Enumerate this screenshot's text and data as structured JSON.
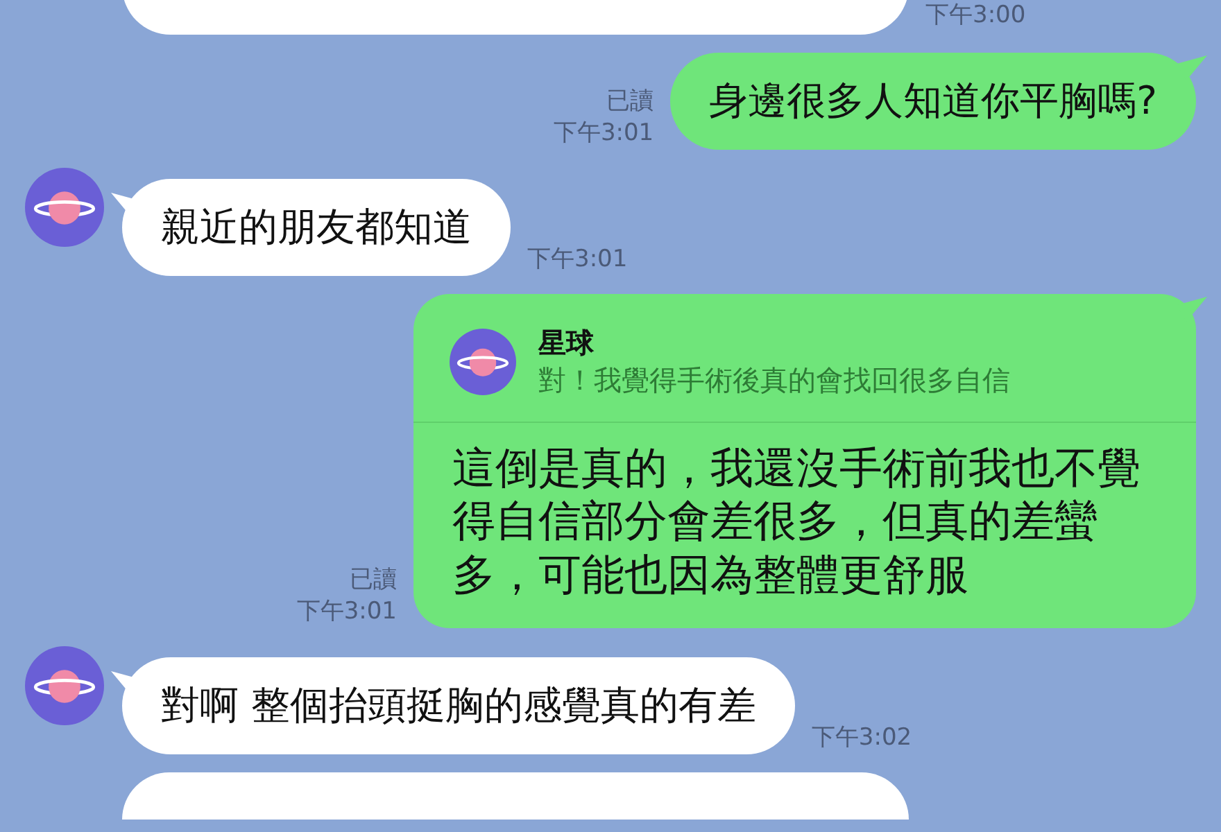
{
  "messages": [
    {
      "kind": "received",
      "time": "下午3:00"
    },
    {
      "kind": "sent",
      "read": "已讀",
      "time": "下午3:01",
      "text": "身邊很多人知道你平胸嗎?"
    },
    {
      "kind": "received",
      "avatar": true,
      "text": "親近的朋友都知道",
      "time": "下午3:01"
    },
    {
      "kind": "sent",
      "read": "已讀",
      "time": "下午3:01",
      "reply_to": {
        "name": "星球",
        "text": "對！我覺得手術後真的會找回很多自信"
      },
      "text": "這倒是真的，我還沒手術前我也不覺得自信部分會差很多，但真的差蠻多，可能也因為整體更舒服"
    },
    {
      "kind": "received",
      "avatar": true,
      "text": "對啊 整個抬頭挺胸的感覺真的有差",
      "time": "下午3:02"
    },
    {
      "kind": "received"
    }
  ]
}
